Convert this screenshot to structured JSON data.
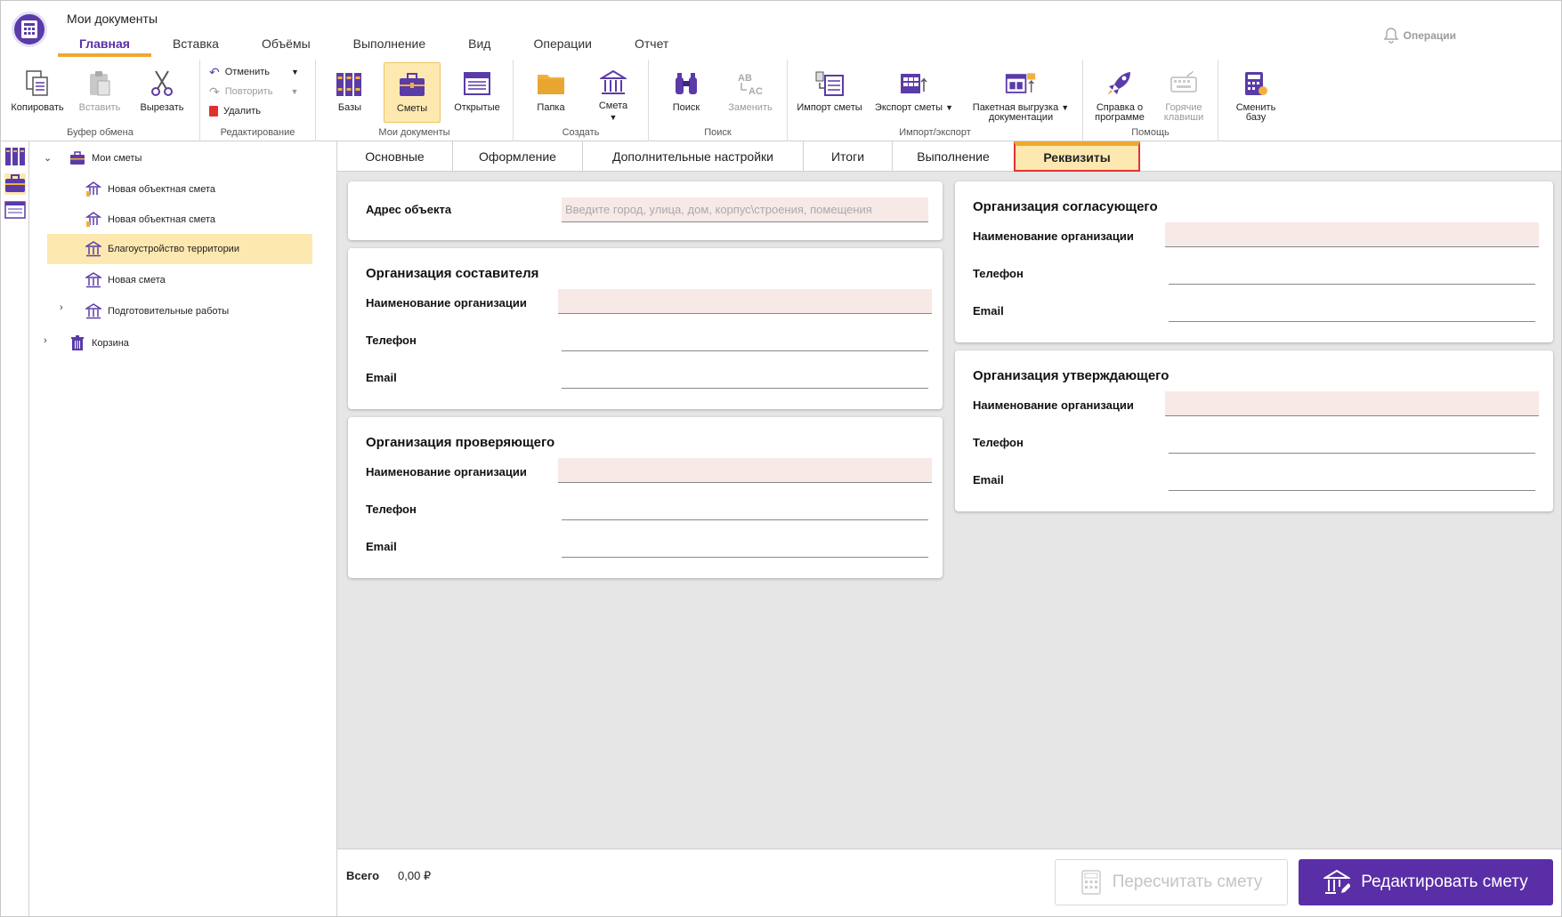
{
  "app": {
    "title": "Мои документы"
  },
  "menu": [
    "Главная",
    "Вставка",
    "Объёмы",
    "Выполнение",
    "Вид",
    "Операции",
    "Отчет"
  ],
  "header": {
    "operations_label": "Операции"
  },
  "ribbon": {
    "clipboard": {
      "label": "Буфер обмена",
      "copy": "Копировать",
      "paste": "Вставить",
      "cut": "Вырезать"
    },
    "editing": {
      "label": "Редактирование",
      "undo": "Отменить",
      "redo": "Повторить",
      "delete": "Удалить"
    },
    "my_documents": {
      "label": "Мои документы",
      "bases": "Базы",
      "estimates": "Сметы",
      "open": "Открытые"
    },
    "create": {
      "label": "Создать",
      "folder": "Папка",
      "estimate": "Смета"
    },
    "search": {
      "label": "Поиск",
      "find": "Поиск",
      "replace": "Заменить"
    },
    "import_export": {
      "label": "Импорт/экспорт",
      "import": "Импорт сметы",
      "export": "Экспорт сметы",
      "batch_1": "Пакетная выгрузка",
      "batch_2": "документации"
    },
    "help": {
      "label": "Помощь",
      "about_1": "Справка о",
      "about_2": "программе",
      "hotkeys_1": "Горячие",
      "hotkeys_2": "клавиши"
    },
    "switch_base": {
      "l1": "Сменить",
      "l2": "базу"
    }
  },
  "tree": {
    "root": "Мои сметы",
    "items": [
      "Новая объектная смета",
      "Новая объектная смета",
      "Благоустройство территории",
      "Новая смета",
      "Подготовительные работы"
    ],
    "trash": "Корзина"
  },
  "tabs": [
    "Основные",
    "Оформление",
    "Дополнительные настройки",
    "Итоги",
    "Выполнение",
    "Реквизиты"
  ],
  "form": {
    "address": {
      "label": "Адрес объекта",
      "placeholder": "Введите город, улица, дом, корпус\\строения, помещения"
    },
    "compiler": {
      "title": "Организация составителя"
    },
    "checker": {
      "title": "Организация проверяющего"
    },
    "approver_agree": {
      "title": "Организация согласующего"
    },
    "approver_final": {
      "title": "Организация утверждающего"
    },
    "org_name_label": "Наименование организации",
    "phone_label": "Телефон",
    "email_label": "Email"
  },
  "footer": {
    "total_label": "Всего",
    "total_value": "0,00 ₽",
    "recalc": "Пересчитать смету",
    "edit": "Редактировать смету"
  },
  "colors": {
    "accent": "#5a2ea6",
    "highlight": "#fde9b0",
    "tab_marker": "#f0a830",
    "field_bg": "#f7e9e6"
  }
}
